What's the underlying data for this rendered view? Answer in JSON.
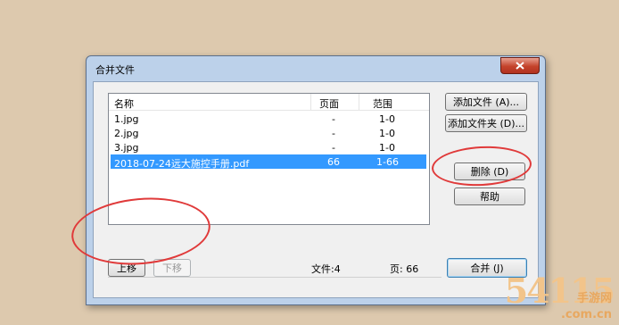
{
  "window": {
    "title": "合并文件",
    "close_icon": "close-icon"
  },
  "columns": [
    "名称",
    "页面",
    "范围"
  ],
  "rows": [
    {
      "name": "1.jpg",
      "pages": "-",
      "range": "1-0",
      "selected": false
    },
    {
      "name": "2.jpg",
      "pages": "-",
      "range": "1-0",
      "selected": false
    },
    {
      "name": "3.jpg",
      "pages": "-",
      "range": "1-0",
      "selected": false
    },
    {
      "name": "2018-07-24远大施控手册.pdf",
      "pages": "66",
      "range": "1-66",
      "selected": true
    }
  ],
  "buttons": {
    "add_file": "添加文件 (A)...",
    "add_folder": "添加文件夹 (D)...",
    "delete": "删除 (D)",
    "help": "帮助",
    "move_up": "上移",
    "move_down": "下移",
    "merge": "合并 (J)"
  },
  "status": {
    "files": "文件:4",
    "pages": "页: 66"
  },
  "watermark": {
    "main": "54115",
    "sub": "手游网",
    "sub2": ".com.cn"
  },
  "colors": {
    "selection": "#3399ff",
    "annotation": "#e03a3a",
    "title_bar": "#bcd1ea"
  }
}
